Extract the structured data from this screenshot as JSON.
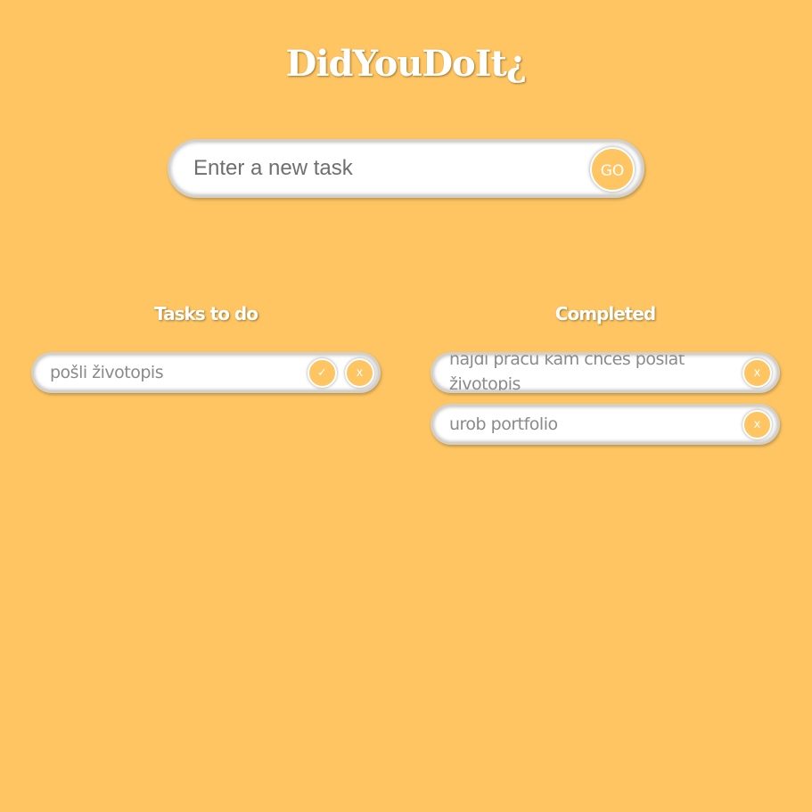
{
  "app": {
    "title": "DidYouDoIt¿"
  },
  "new_task": {
    "placeholder": "Enter a new task",
    "value": "",
    "submit_label": "GO"
  },
  "todo": {
    "heading": "Tasks to do",
    "items": [
      {
        "text": "pošli životopis",
        "complete_label": "✓",
        "delete_label": "x"
      }
    ]
  },
  "completed": {
    "heading": "Completed",
    "items": [
      {
        "text": "nájdi prácu kam chceš poslať životopis",
        "delete_label": "x"
      },
      {
        "text": "urob portfolio",
        "delete_label": "x"
      }
    ]
  },
  "colors": {
    "background": "#FEC562",
    "accent_button": "#FEC562",
    "card": "#FFFFFF",
    "item_text": "#8A8A8A"
  }
}
